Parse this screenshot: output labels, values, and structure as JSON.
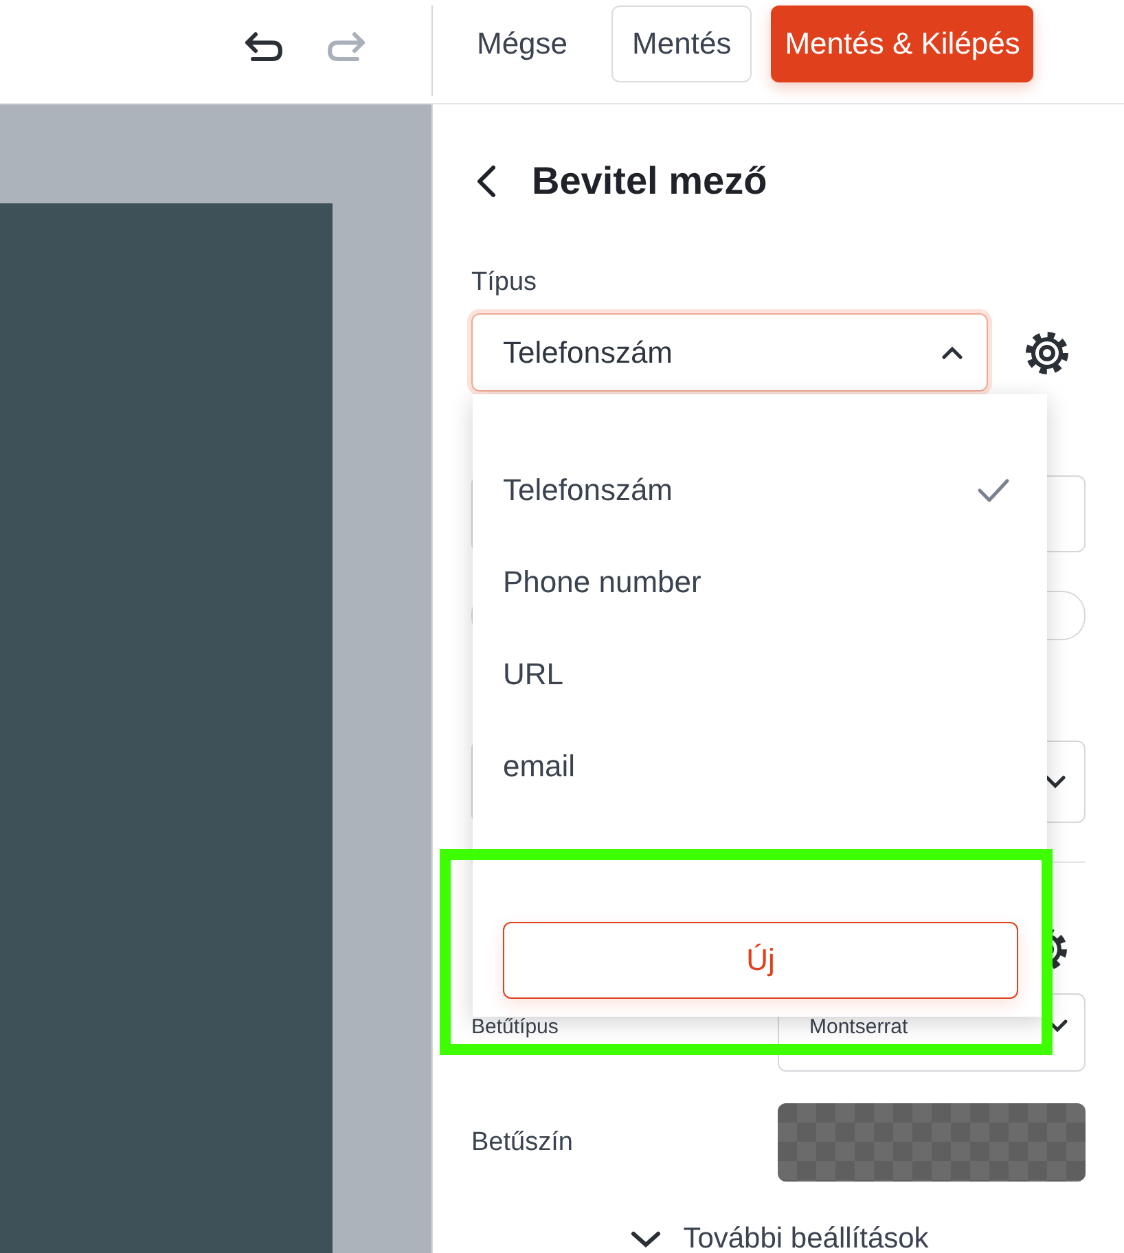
{
  "toolbar": {
    "history": [
      {
        "kind": "undo",
        "disabled": false
      },
      {
        "kind": "redo",
        "disabled": true
      }
    ],
    "buttons": [
      {
        "label": "Mégse",
        "kind": "text"
      },
      {
        "label": "Mentés",
        "kind": "outline"
      },
      {
        "label": "Mentés & Kilépés",
        "kind": "primary"
      }
    ]
  },
  "panel": {
    "title": "Bevitel mező",
    "type_label": "Típus",
    "type_value": "Telefonszám",
    "dropdown": {
      "expanded": true,
      "options": [
        {
          "label": "Telefonszám",
          "selected": true
        },
        {
          "label": "Phone number",
          "selected": false
        },
        {
          "label": "URL",
          "selected": false
        },
        {
          "label": "email",
          "selected": false
        }
      ],
      "new_button": "Új"
    },
    "font_label": "Betűtípus",
    "font_value": "Montserrat",
    "color_label": "Betűszín",
    "more": "További beállítások"
  }
}
